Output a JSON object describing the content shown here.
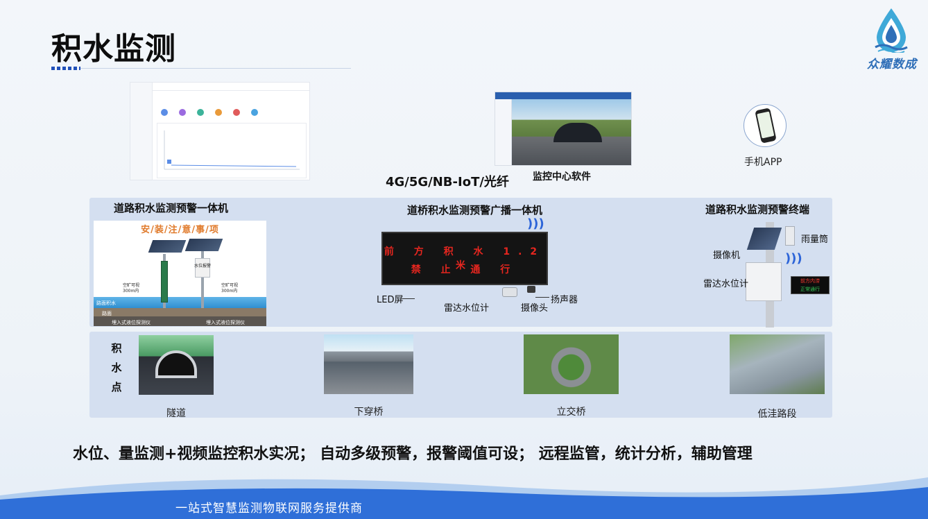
{
  "page": {
    "title": "积水监测",
    "network": "4G/5G/NB-IoT/光纤",
    "features": "水位、量监测+视频监控积水实况；   自动多级预警，报警阈值可设；    远程监管，统计分析，辅助管理",
    "footer": "一站式智慧监测物联网服务提供商"
  },
  "brand": {
    "name": "众耀数成",
    "color": "#2f6fb8"
  },
  "platform": {
    "monitor_label": "监控中心软件",
    "app_label": "手机APP"
  },
  "devices": {
    "integrated": {
      "title": "道路积水监测预警一体机",
      "install_heading": "安/装/注/意/事/项",
      "small_labels": [
        "空旷可视",
        "300m内",
        "空旷可视",
        "300m内",
        "路面积水",
        "路面",
        "埋入式液位探测仪",
        "埋入式液位探测仪",
        "水位报警"
      ]
    },
    "bridge": {
      "title": "道桥积水监测预警广播一体机",
      "led_line1": "前 方 积 水 1.2 米",
      "led_line2": "禁 止 通 行",
      "callouts": [
        "LED屏",
        "雷达水位计",
        "摄像头",
        "扬声器"
      ]
    },
    "terminal": {
      "title": "道路积水监测预警终端",
      "callouts": [
        "雨量筒",
        "摄像机",
        "雷达水位计"
      ],
      "led_line1": "前方内涝",
      "led_line2": "正常通行"
    }
  },
  "sites": {
    "label": "积水点",
    "items": [
      {
        "name": "隧道"
      },
      {
        "name": "下穿桥"
      },
      {
        "name": "立交桥"
      },
      {
        "name": "低洼路段"
      }
    ]
  },
  "colors": {
    "panel": "#d4dff0",
    "led_text": "#e5261f",
    "accent": "#2c64d8"
  }
}
